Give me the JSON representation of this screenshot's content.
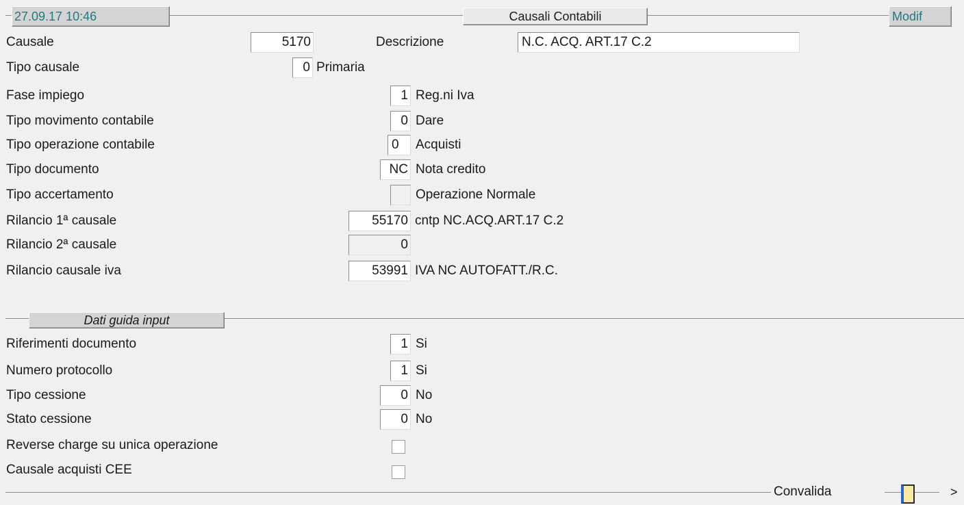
{
  "header": {
    "datetime": "27.09.17 10:46",
    "title": "Causali Contabili",
    "mode": "Modif"
  },
  "form": {
    "causale": {
      "label": "Causale",
      "value": "5170"
    },
    "descrizione": {
      "label": "Descrizione",
      "value": "N.C. ACQ.  ART.17 C.2"
    },
    "tipo_causale": {
      "label": "Tipo causale",
      "value": "0",
      "desc": "Primaria"
    },
    "fase_impiego": {
      "label": "Fase impiego",
      "value": "1",
      "desc": "Reg.ni Iva"
    },
    "tipo_movimento": {
      "label": "Tipo movimento contabile",
      "value": "0",
      "desc": "Dare"
    },
    "tipo_operazione": {
      "label": "Tipo operazione contabile",
      "value": "0",
      "desc": "Acquisti"
    },
    "tipo_documento": {
      "label": "Tipo documento",
      "value": "NC",
      "desc": "Nota credito"
    },
    "tipo_accertamento": {
      "label": "Tipo accertamento",
      "value": "",
      "desc": "Operazione Normale"
    },
    "rilancio_1": {
      "label": "Rilancio 1ª causale",
      "value": "55170",
      "desc": "cntp NC.ACQ.ART.17 C.2"
    },
    "rilancio_2": {
      "label": "Rilancio 2ª causale",
      "value": "0",
      "desc": ""
    },
    "rilancio_iva": {
      "label": "Rilancio causale iva",
      "value": "53991",
      "desc": "IVA NC AUTOFATT./R.C."
    }
  },
  "section_guida": {
    "title": "Dati guida input",
    "riferimenti": {
      "label": "Riferimenti documento",
      "value": "1",
      "desc": "Si"
    },
    "protocollo": {
      "label": "Numero protocollo",
      "value": "1",
      "desc": "Si"
    },
    "tipo_cessione": {
      "label": "Tipo cessione",
      "value": "0",
      "desc": "No"
    },
    "stato_cessione": {
      "label": "Stato cessione",
      "value": "0",
      "desc": "No"
    },
    "reverse_charge": {
      "label": "Reverse charge su unica operazione",
      "checked": false
    },
    "acquisti_cee": {
      "label": "Causale acquisti CEE",
      "checked": false
    }
  },
  "footer": {
    "convalida": "Convalida",
    "next": ">"
  },
  "colors": {
    "background": "#f0f0f0",
    "header_text": "#1f7a80",
    "indicator": "#fbe9a8"
  }
}
